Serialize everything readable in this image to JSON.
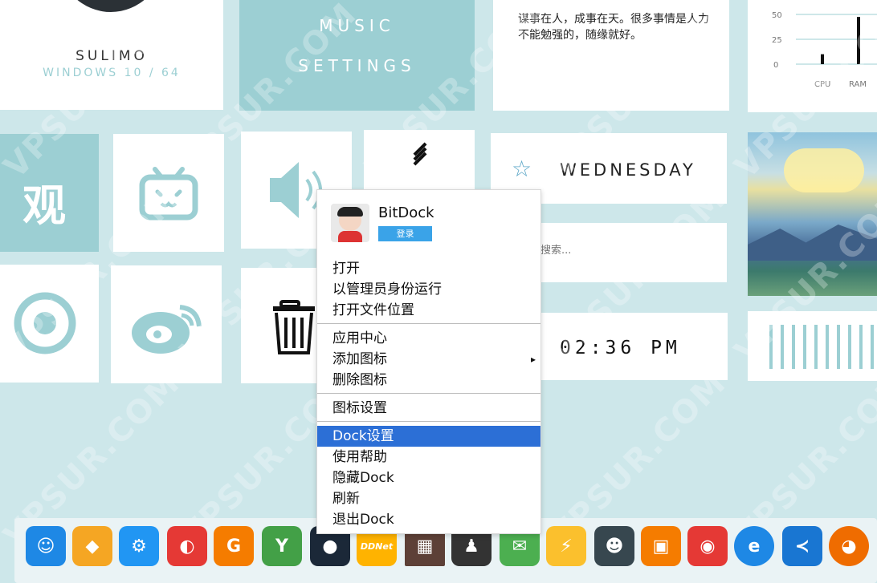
{
  "profile": {
    "name": "SULIMO",
    "subtitle": "WINDOWS 10 / 64"
  },
  "music": {
    "line1": "MUSIC",
    "line2": "SETTINGS"
  },
  "quote": {
    "text": "谋事在人，成事在天。很多事情是人力不能勉强的，随缘就好。"
  },
  "monitor": {
    "ticks": [
      "50",
      "25",
      "0"
    ],
    "labels": [
      "CPU",
      "RAM"
    ],
    "cpu": 0.2,
    "ram": 0.95
  },
  "tiles": {
    "guan_label": "观"
  },
  "day": {
    "label": "WEDNESDAY"
  },
  "search": {
    "placeholder": "搜索..."
  },
  "clock": {
    "time": "02:36 PM"
  },
  "context_menu": {
    "app_name": "BitDock",
    "login_label": "登录",
    "items": [
      {
        "label": "打开"
      },
      {
        "label": "以管理员身份运行"
      },
      {
        "label": "打开文件位置"
      },
      {
        "label": "应用中心"
      },
      {
        "label": "添加图标",
        "submenu_arrow": "▸"
      },
      {
        "label": "删除图标"
      },
      {
        "label": "图标设置"
      },
      {
        "label": "Dock设置",
        "state": "highlighted"
      },
      {
        "label": "使用帮助"
      },
      {
        "label": "隐藏Dock"
      },
      {
        "label": "刷新"
      },
      {
        "label": "退出Dock"
      }
    ]
  },
  "dock": {
    "items": [
      {
        "icon": "finder-face-icon",
        "color": "#1e88e5"
      },
      {
        "icon": "flame-shield-icon",
        "color": "#f5a623"
      },
      {
        "icon": "settings-gear-icon",
        "color": "#2196f3"
      },
      {
        "icon": "disk-tool-icon",
        "color": "#e53935"
      },
      {
        "icon": "g-badge-icon",
        "color": "#f57c00"
      },
      {
        "icon": "y-circle-icon",
        "color": "#43a047"
      },
      {
        "icon": "steam-icon",
        "color": "#1b2838"
      },
      {
        "icon": "ddnet-icon",
        "color": "#ffb300",
        "text": "DDNet"
      },
      {
        "icon": "pixel-game-icon",
        "color": "#5d4037"
      },
      {
        "icon": "qq-penguin-icon",
        "color": "#333333"
      },
      {
        "icon": "wechat-icon",
        "color": "#4caf50"
      },
      {
        "icon": "lightning-icon",
        "color": "#fbc02d"
      },
      {
        "icon": "cat-icon",
        "color": "#37474f"
      },
      {
        "icon": "vmware-icon",
        "color": "#f57c00"
      },
      {
        "icon": "pin-circle-icon",
        "color": "#e53935"
      },
      {
        "icon": "edge-icon",
        "color": "#1e88e5"
      },
      {
        "icon": "vscode-icon",
        "color": "#1976d2"
      },
      {
        "icon": "firefox-icon",
        "color": "#ef6c00"
      }
    ]
  },
  "watermark": "VPSUR.COM"
}
